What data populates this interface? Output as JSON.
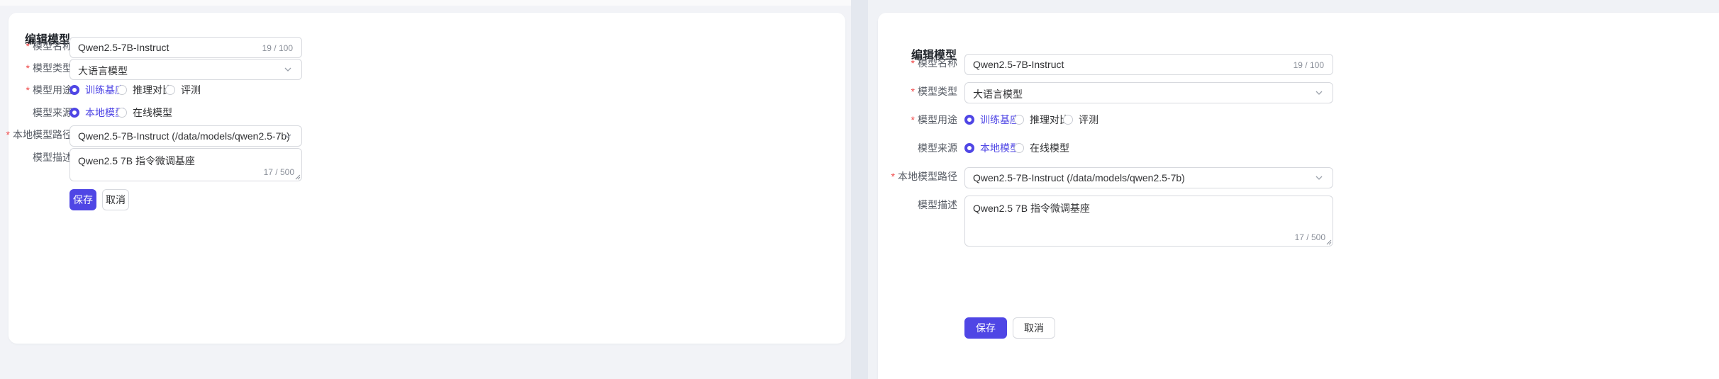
{
  "form": {
    "title": "编辑模型",
    "required_mark": "*",
    "name": {
      "label": "模型名称",
      "value": "Qwen2.5-7B-Instruct",
      "count": "19 / 100"
    },
    "type": {
      "label": "模型类型",
      "value": "大语言模型"
    },
    "purpose": {
      "label": "模型用途",
      "options": [
        "训练基座",
        "推理对比",
        "评测"
      ],
      "selected": "训练基座"
    },
    "source": {
      "label": "模型来源",
      "options": [
        "本地模型",
        "在线模型"
      ],
      "selected": "本地模型"
    },
    "path": {
      "label": "本地模型路径",
      "value": "Qwen2.5-7B-Instruct (/data/models/qwen2.5-7b)"
    },
    "description": {
      "label": "模型描述",
      "value": "Qwen2.5 7B 指令微调基座",
      "count": "17 / 500"
    },
    "save_label": "保存",
    "cancel_label": "取消"
  },
  "colors": {
    "accent": "#4f46e5",
    "required": "#f04848",
    "page_bg": "#f2f3f7",
    "border": "#d7d9de"
  },
  "icons": {
    "select_arrow": "chevron-down-icon",
    "resize": "resize-grip-icon"
  }
}
